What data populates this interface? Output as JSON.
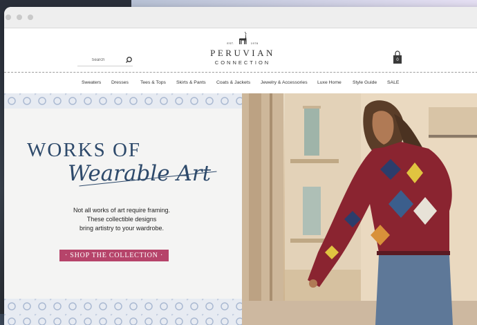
{
  "header": {
    "search_placeholder": "Search",
    "logo": {
      "est": "EST.",
      "year": "1976",
      "name": "PERUVIAN",
      "sub": "CONNECTION"
    },
    "cart_count": "0"
  },
  "nav": {
    "items": [
      "Sweaters",
      "Dresses",
      "Tees & Tops",
      "Skirts & Pants",
      "Coats & Jackets",
      "Jewelry & Accessories",
      "Luxe Home",
      "Style Guide",
      "SALE"
    ]
  },
  "hero": {
    "title": "WORKS OF",
    "script": "Wearable Art",
    "copy_1": "Not all works of art require framing.",
    "copy_2": "These collectible designs",
    "copy_3": "bring artistry to your wardrobe.",
    "cta": "· SHOP THE COLLECTION ·"
  },
  "colors": {
    "brand_navy": "#2e4a6b",
    "cta": "#b6446a"
  }
}
